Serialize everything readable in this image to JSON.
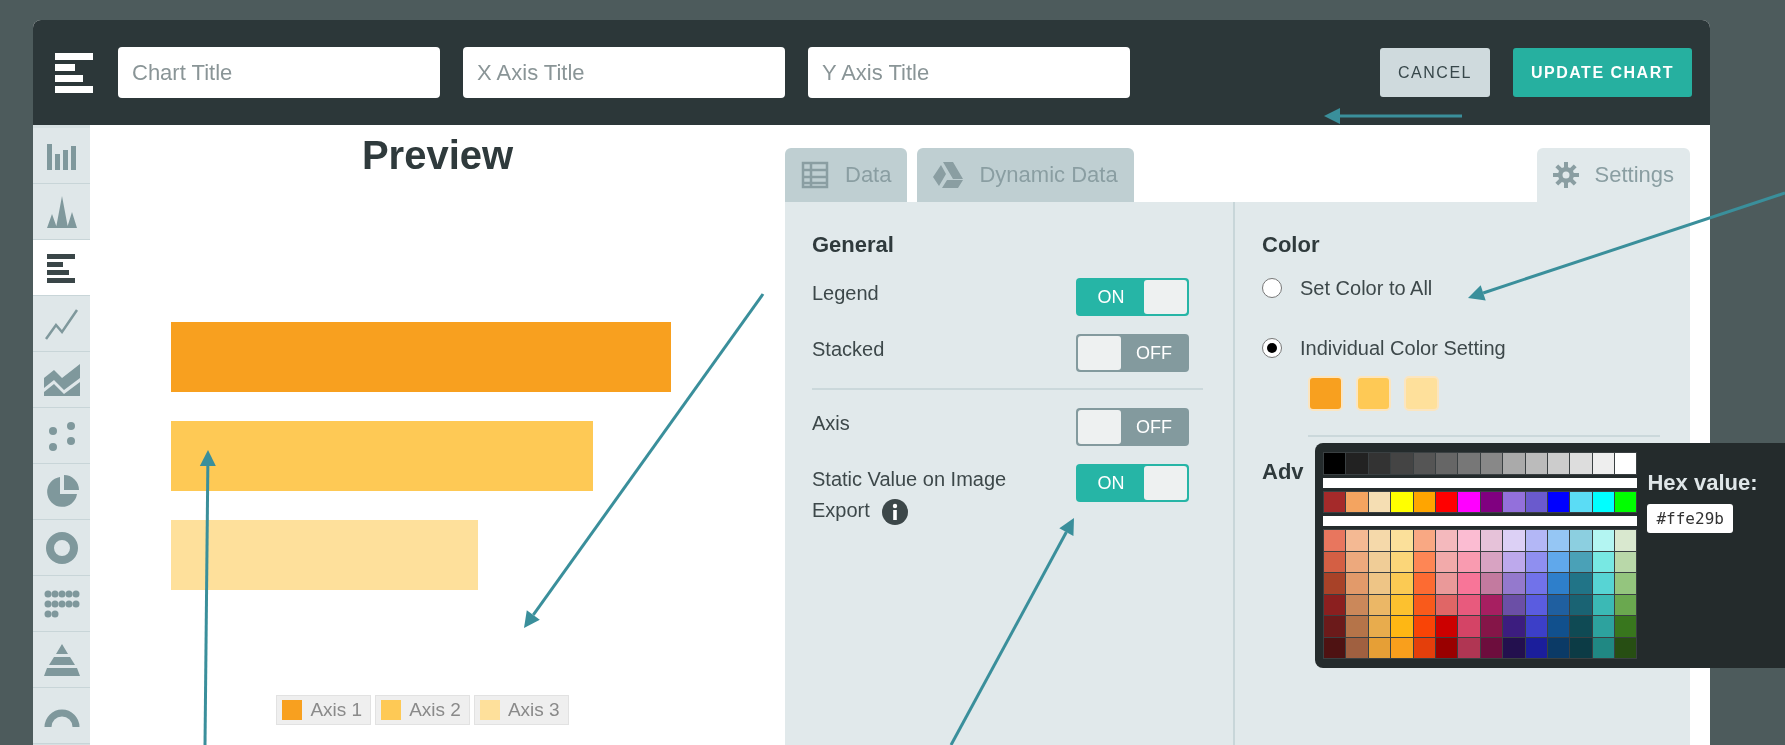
{
  "header": {
    "title_fields": [
      {
        "placeholder": "Chart Title"
      },
      {
        "placeholder": "X Axis Title"
      },
      {
        "placeholder": "Y Axis Title"
      }
    ],
    "buttons": [
      {
        "label": "CANCEL",
        "kind": "secondary"
      },
      {
        "label": "UPDATE CHART",
        "kind": "primary"
      }
    ]
  },
  "sidebar": {
    "items": [
      {
        "selected": false
      },
      {
        "selected": false
      },
      {
        "selected": true
      },
      {
        "selected": false
      },
      {
        "selected": false
      },
      {
        "selected": false
      },
      {
        "selected": false
      },
      {
        "selected": false
      },
      {
        "selected": false
      },
      {
        "selected": false
      },
      {
        "selected": false
      }
    ]
  },
  "preview": {
    "title": "Preview",
    "series": [
      {
        "label": "Axis 1",
        "color": "#f8a01f"
      },
      {
        "label": "Axis 2",
        "color": "#fec955"
      },
      {
        "label": "Axis 3",
        "color": "#fee09b"
      }
    ]
  },
  "settings": {
    "tabs": [
      {
        "label": "Data",
        "selected": false
      },
      {
        "label": "Dynamic Data",
        "selected": false
      },
      {
        "label": "Settings",
        "selected": true
      }
    ],
    "general": {
      "heading": "General",
      "groups": [
        [
          {
            "label": "Legend",
            "on": true,
            "state_label": "ON"
          },
          {
            "label": "Stacked",
            "on": false,
            "state_label": "OFF"
          }
        ],
        [
          {
            "label": "Axis",
            "on": false,
            "state_label": "OFF"
          },
          {
            "label": "Static Value on Image Export",
            "on": true,
            "state_label": "ON",
            "has_info": true
          }
        ]
      ]
    },
    "color": {
      "heading": "Color",
      "options": [
        {
          "label": "Set Color to All",
          "selected": false
        },
        {
          "label": "Individual Color Setting",
          "selected": true
        }
      ],
      "swatches": [
        {
          "color": "#f8a01f"
        },
        {
          "color": "#fec955"
        },
        {
          "color": "#fee09b"
        }
      ],
      "next_heading": "Adv"
    }
  },
  "color_picker": {
    "hex_label": "Hex value:",
    "hex_value": "#ffe29b",
    "palette_groups": [
      [
        [
          {
            "color": "#000000"
          },
          {
            "color": "#222222"
          },
          {
            "color": "#333333"
          },
          {
            "color": "#444444"
          },
          {
            "color": "#555555"
          },
          {
            "color": "#666666"
          },
          {
            "color": "#777777"
          },
          {
            "color": "#888888"
          },
          {
            "color": "#aaaaaa"
          },
          {
            "color": "#bbbbbb"
          },
          {
            "color": "#cccccc"
          },
          {
            "color": "#dddddd"
          },
          {
            "color": "#eeeeee"
          },
          {
            "color": "#ffffff"
          }
        ]
      ],
      [
        [
          {
            "color": "#a52a2a"
          },
          {
            "color": "#f4a460"
          },
          {
            "color": "#f5deb3"
          },
          {
            "color": "#ffff00"
          },
          {
            "color": "#ffa500"
          },
          {
            "color": "#ff0000"
          },
          {
            "color": "#ff00ff"
          },
          {
            "color": "#800080"
          },
          {
            "color": "#9370db"
          },
          {
            "color": "#6a5acd"
          },
          {
            "color": "#0000ff"
          },
          {
            "color": "#5bdcf5"
          },
          {
            "color": "#00ffff"
          },
          {
            "color": "#00ff00"
          }
        ]
      ],
      [
        [
          {
            "color": "#e8765e"
          },
          {
            "color": "#f4b993"
          },
          {
            "color": "#f5d9aa"
          },
          {
            "color": "#fbe09a"
          },
          {
            "color": "#f9a883"
          },
          {
            "color": "#f4b9bd"
          },
          {
            "color": "#fbbcd2"
          },
          {
            "color": "#e6c2d9"
          },
          {
            "color": "#dcd0f5"
          },
          {
            "color": "#b3b7f6"
          },
          {
            "color": "#95c6f4"
          },
          {
            "color": "#8ccfe0"
          },
          {
            "color": "#b3f5f2"
          },
          {
            "color": "#d9e8cf"
          }
        ],
        [
          {
            "color": "#d45f44"
          },
          {
            "color": "#eda97d"
          },
          {
            "color": "#f0cd97"
          },
          {
            "color": "#fbd679"
          },
          {
            "color": "#fe8655"
          },
          {
            "color": "#f2aaaa"
          },
          {
            "color": "#f99bb0"
          },
          {
            "color": "#d8a3c2"
          },
          {
            "color": "#bda9ec"
          },
          {
            "color": "#8f8ff0"
          },
          {
            "color": "#60a8eb"
          },
          {
            "color": "#4aa1b7"
          },
          {
            "color": "#78e8e3"
          },
          {
            "color": "#b9d8a9"
          }
        ],
        [
          {
            "color": "#a84228"
          },
          {
            "color": "#e29a6a"
          },
          {
            "color": "#eec586"
          },
          {
            "color": "#fbca53"
          },
          {
            "color": "#fd6b32"
          },
          {
            "color": "#ea9999"
          },
          {
            "color": "#f87598"
          },
          {
            "color": "#c37a9f"
          },
          {
            "color": "#9479cd"
          },
          {
            "color": "#7172ea"
          },
          {
            "color": "#2e7fcb"
          },
          {
            "color": "#217487"
          },
          {
            "color": "#57d4d4"
          },
          {
            "color": "#94c57e"
          }
        ],
        [
          {
            "color": "#8b1f1f"
          },
          {
            "color": "#cb885a"
          },
          {
            "color": "#ebb766"
          },
          {
            "color": "#fcc12f"
          },
          {
            "color": "#f95a1b"
          },
          {
            "color": "#e06666"
          },
          {
            "color": "#e85a7d"
          },
          {
            "color": "#a71f61"
          },
          {
            "color": "#6b4fa6"
          },
          {
            "color": "#5a5ce0"
          },
          {
            "color": "#1f5fa0"
          },
          {
            "color": "#1a6373"
          },
          {
            "color": "#3bb9b5"
          },
          {
            "color": "#6aa84f"
          }
        ],
        [
          {
            "color": "#6b1a1a"
          },
          {
            "color": "#b57449"
          },
          {
            "color": "#e8ac4d"
          },
          {
            "color": "#feb714"
          },
          {
            "color": "#f94406"
          },
          {
            "color": "#cc0000"
          },
          {
            "color": "#d44466"
          },
          {
            "color": "#851548"
          },
          {
            "color": "#3c1d7f"
          },
          {
            "color": "#3c3fc8"
          },
          {
            "color": "#11508d"
          },
          {
            "color": "#0f4a54"
          },
          {
            "color": "#2da29e"
          },
          {
            "color": "#38761d"
          }
        ],
        [
          {
            "color": "#4e1212"
          },
          {
            "color": "#a06040"
          },
          {
            "color": "#e69f36"
          },
          {
            "color": "#f99f1c"
          },
          {
            "color": "#e43f0b"
          },
          {
            "color": "#990000"
          },
          {
            "color": "#b03653"
          },
          {
            "color": "#6d0d3d"
          },
          {
            "color": "#23104e"
          },
          {
            "color": "#1b1e9b"
          },
          {
            "color": "#0b3a66"
          },
          {
            "color": "#0c3b45"
          },
          {
            "color": "#208883"
          },
          {
            "color": "#274e13"
          }
        ]
      ]
    ]
  }
}
